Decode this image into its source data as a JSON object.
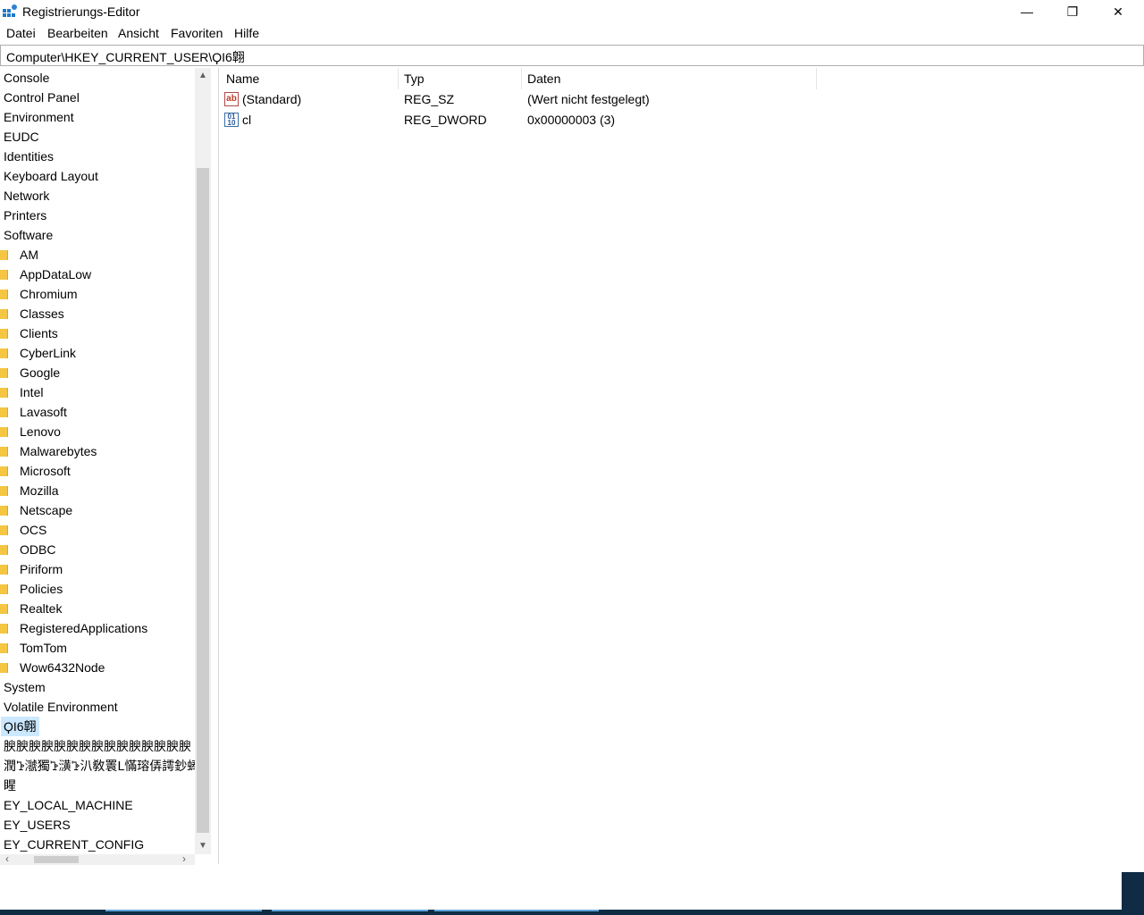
{
  "window": {
    "title": "Registrierungs-Editor",
    "minimize": "—",
    "maximize": "❐",
    "close": "✕"
  },
  "menu": [
    "Datei",
    "Bearbeiten",
    "Ansicht",
    "Favoriten",
    "Hilfe"
  ],
  "address": "Computer\\HKEY_CURRENT_USER\\ϘӀ6翺",
  "tree": {
    "top_items": [
      "Console",
      "Control Panel",
      "Environment",
      "EUDC",
      "Identities",
      "Keyboard Layout",
      "Network",
      "Printers",
      "Software"
    ],
    "software_children": [
      "AM",
      "AppDataLow",
      "Chromium",
      "Classes",
      "Clients",
      "CyberLink",
      "Google",
      "Intel",
      "Lavasoft",
      "Lenovo",
      "Malwarebytes",
      "Microsoft",
      "Mozilla",
      "Netscape",
      "OCS",
      "ODBC",
      "Piriform",
      "Policies",
      "Realtek",
      "RegisteredApplications",
      "TomTom",
      "Wow6432Node"
    ],
    "after_items": [
      "System",
      "Volatile Environment"
    ],
    "selected": "ϘӀ6翺",
    "garbled": [
      "腴腴腴腴腴腴腴腴腴腴腴腴腴腴腴",
      "潤ꕲ㶁獨ꕲ㶂ꕲ汃敎瞏ꓡ慲瑢㑝謣鈔蜯ꔢ",
      "睲"
    ],
    "hives": [
      "EY_LOCAL_MACHINE",
      "EY_USERS",
      "EY_CURRENT_CONFIG"
    ]
  },
  "columns": {
    "name": "Name",
    "type": "Typ",
    "data": "Daten"
  },
  "values": [
    {
      "name": "(Standard)",
      "type": "REG_SZ",
      "data": "(Wert nicht festgelegt)",
      "icon": "ab-string-icon"
    },
    {
      "name": "cl",
      "type": "REG_DWORD",
      "data": "0x00000003 (3)",
      "icon": "binary-dword-icon"
    }
  ]
}
